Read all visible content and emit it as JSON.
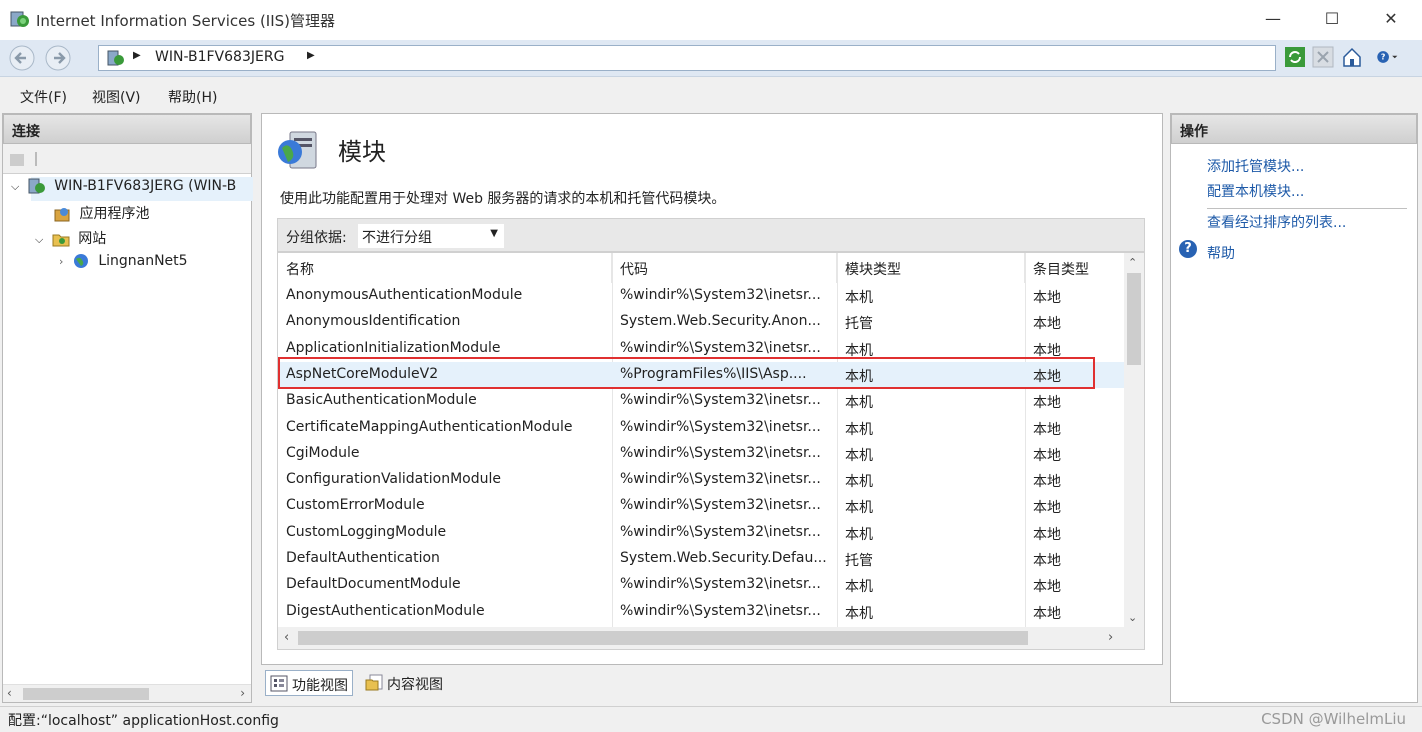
{
  "window": {
    "title": "Internet Information Services (IIS)管理器",
    "minimize": "—",
    "maximize": "☐",
    "close": "✕"
  },
  "address": {
    "breadcrumb": "WIN-B1FV683JERG"
  },
  "menu": {
    "file": "文件(F)",
    "view": "视图(V)",
    "help": "帮助(H)"
  },
  "connections": {
    "header": "连接",
    "tree": {
      "server": "WIN-B1FV683JERG (WIN-B",
      "app_pools": "应用程序池",
      "sites": "网站",
      "site1": "LingnanNet5"
    }
  },
  "modules": {
    "title": "模块",
    "description": "使用此功能配置用于处理对 Web 服务器的请求的本机和托管代码模块。",
    "group_label": "分组依据:",
    "group_value": "不进行分组",
    "columns": [
      "名称",
      "代码",
      "模块类型",
      "条目类型"
    ],
    "rows": [
      [
        "AnonymousAuthenticationModule",
        "%windir%\\System32\\inetsr...",
        "本机",
        "本地"
      ],
      [
        "AnonymousIdentification",
        "System.Web.Security.Anon...",
        "托管",
        "本地"
      ],
      [
        "ApplicationInitializationModule",
        "%windir%\\System32\\inetsr...",
        "本机",
        "本地"
      ],
      [
        "AspNetCoreModuleV2",
        "%ProgramFiles%\\IIS\\Asp....",
        "本机",
        "本地"
      ],
      [
        "BasicAuthenticationModule",
        "%windir%\\System32\\inetsr...",
        "本机",
        "本地"
      ],
      [
        "CertificateMappingAuthenticationModule",
        "%windir%\\System32\\inetsr...",
        "本机",
        "本地"
      ],
      [
        "CgiModule",
        "%windir%\\System32\\inetsr...",
        "本机",
        "本地"
      ],
      [
        "ConfigurationValidationModule",
        "%windir%\\System32\\inetsr...",
        "本机",
        "本地"
      ],
      [
        "CustomErrorModule",
        "%windir%\\System32\\inetsr...",
        "本机",
        "本地"
      ],
      [
        "CustomLoggingModule",
        "%windir%\\System32\\inetsr...",
        "本机",
        "本地"
      ],
      [
        "DefaultAuthentication",
        "System.Web.Security.Defau...",
        "托管",
        "本地"
      ],
      [
        "DefaultDocumentModule",
        "%windir%\\System32\\inetsr...",
        "本机",
        "本地"
      ],
      [
        "DigestAuthenticationModule",
        "%windir%\\System32\\inetsr...",
        "本机",
        "本地"
      ]
    ],
    "selected_row": 3
  },
  "view_tabs": {
    "features": "功能视图",
    "content": "内容视图"
  },
  "actions": {
    "header": "操作",
    "add_managed": "添加托管模块...",
    "config_native": "配置本机模块...",
    "view_ordered": "查看经过排序的列表...",
    "help": "帮助"
  },
  "status": {
    "text": "配置:“localhost” applicationHost.config",
    "watermark": "CSDN @WilhelmLiu"
  },
  "colors": {
    "link": "#1e5aa8",
    "selection": "#e5f1fb",
    "highlight_border": "#e03030"
  }
}
